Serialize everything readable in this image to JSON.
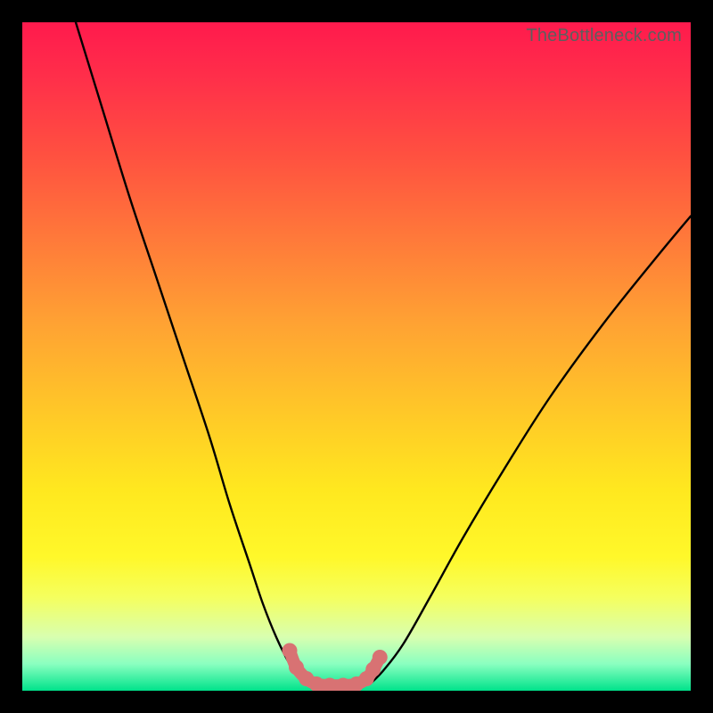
{
  "watermark": "TheBottleneck.com",
  "chart_data": {
    "type": "line",
    "title": "",
    "xlabel": "",
    "ylabel": "",
    "xlim": [
      0,
      100
    ],
    "ylim": [
      0,
      100
    ],
    "grid": false,
    "legend": false,
    "annotations": [],
    "series": [
      {
        "name": "left-branch",
        "color": "#000000",
        "x": [
          8,
          12,
          16,
          20,
          24,
          28,
          31,
          34,
          36,
          38,
          40,
          41.5,
          43
        ],
        "y": [
          100,
          87,
          74,
          62,
          50,
          38,
          28,
          19,
          13,
          8,
          4,
          2,
          1
        ]
      },
      {
        "name": "right-branch",
        "color": "#000000",
        "x": [
          52,
          54,
          57,
          61,
          66,
          72,
          79,
          87,
          95,
          100
        ],
        "y": [
          1,
          3,
          7,
          14,
          23,
          33,
          44,
          55,
          65,
          71
        ]
      },
      {
        "name": "bottom-highlight",
        "color": "#d87273",
        "x": [
          40,
          41,
          42.5,
          44,
          46,
          48,
          50,
          51.5,
          52.5,
          53.5
        ],
        "y": [
          6,
          3.5,
          1.8,
          1,
          0.8,
          0.8,
          1,
          1.8,
          3.2,
          5
        ]
      }
    ]
  }
}
